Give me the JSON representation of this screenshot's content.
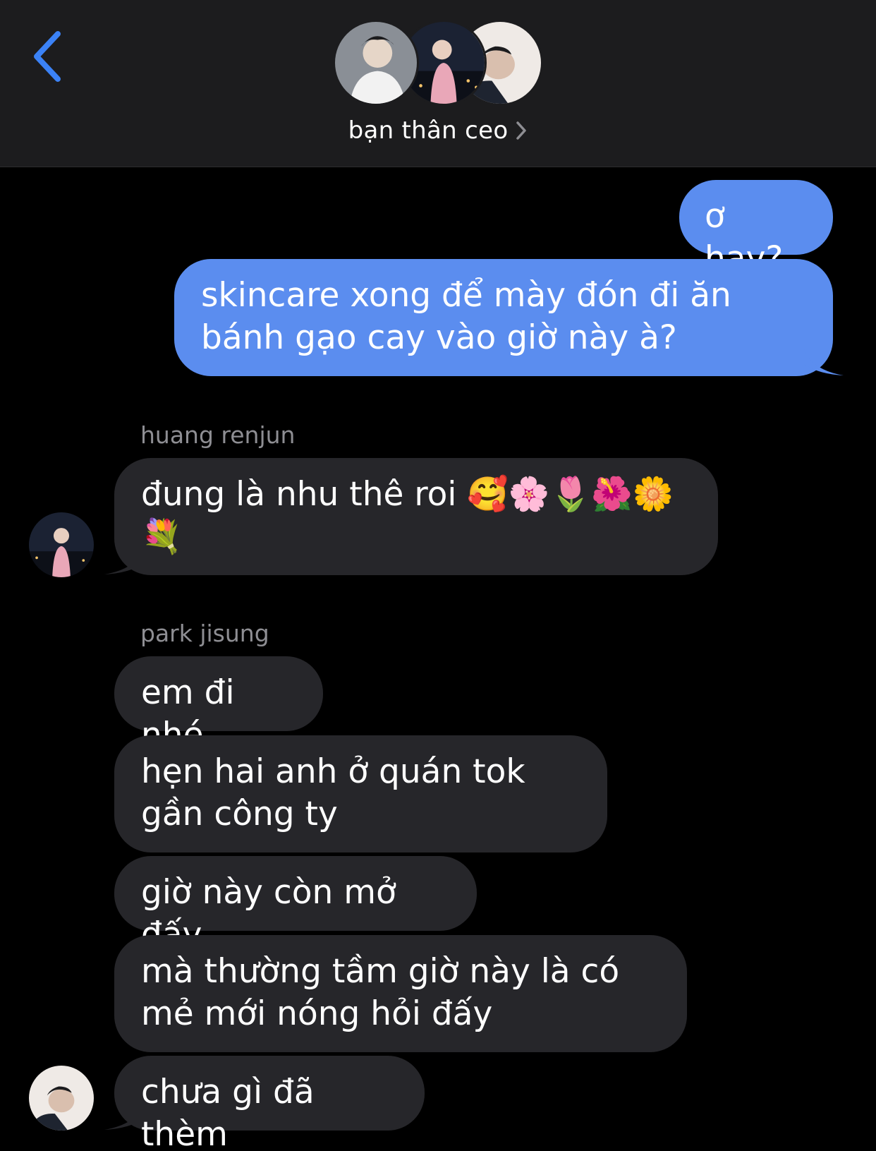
{
  "header": {
    "group_name": "bạn thân ceo",
    "back_icon": "chevron-left-icon",
    "disclosure_icon": "chevron-right-icon"
  },
  "colors": {
    "outgoing_bubble": "#5b8def",
    "incoming_bubble": "#26262a",
    "accent": "#3b82f6",
    "sender_label": "#8e8e93"
  },
  "messages": [
    {
      "direction": "outgoing",
      "text": "ơ hay?"
    },
    {
      "direction": "outgoing",
      "text": "skincare xong để mày đón đi ăn bánh gạo cay vào giờ này à?"
    },
    {
      "direction": "incoming",
      "sender": "huang renjun",
      "text": "đung là nhu thê roi 🥰🌸🌷🌺🌼💐"
    },
    {
      "direction": "incoming",
      "sender": "park jisung",
      "text": "em đi nhé"
    },
    {
      "direction": "incoming",
      "text": "hẹn hai anh ở quán tok gần công ty"
    },
    {
      "direction": "incoming",
      "text": "giờ này còn mở đấy"
    },
    {
      "direction": "incoming",
      "text": "mà thường tầm giờ này là có mẻ mới nóng hỏi đấy"
    },
    {
      "direction": "incoming",
      "text": "chưa gì đã thèm"
    }
  ]
}
